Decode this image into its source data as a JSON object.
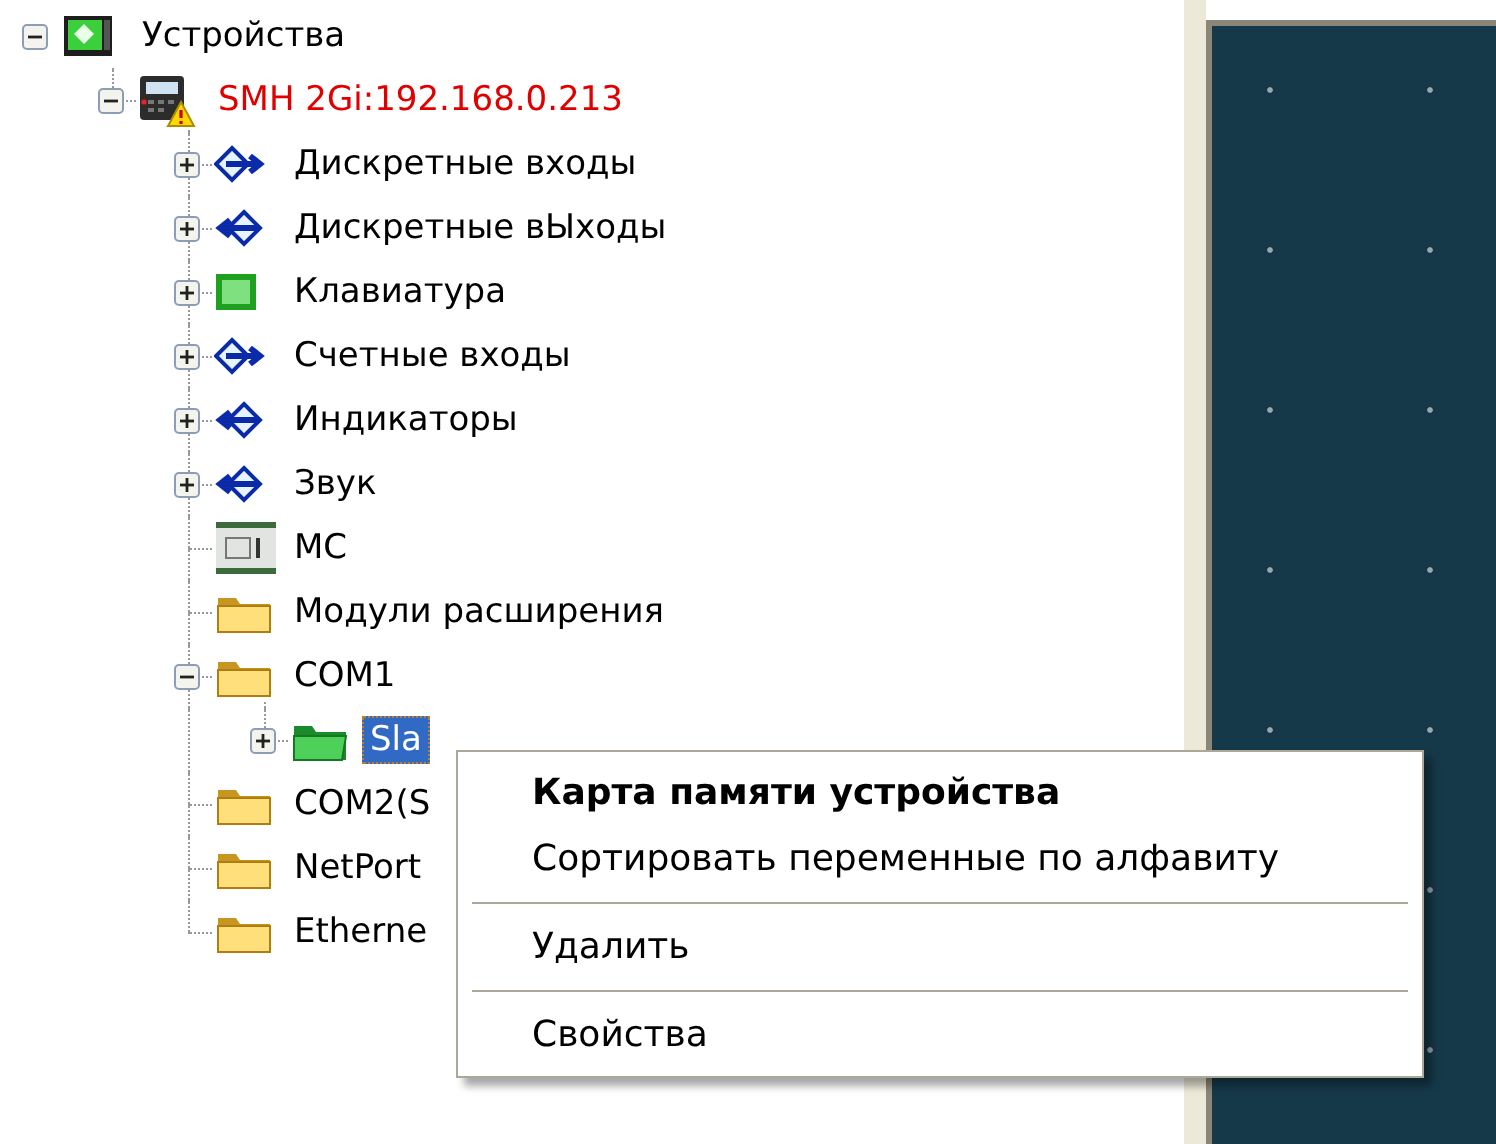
{
  "tree": [
    {
      "label": "Устройства",
      "kind": "devices",
      "toggle": true,
      "expanded": true,
      "selected": false,
      "warning": false,
      "children": [
        {
          "label": "SMH 2Gi:192.168.0.213",
          "kind": "controller",
          "toggle": true,
          "expanded": true,
          "selected": false,
          "warning": true,
          "children": [
            {
              "label": "Дискретные входы",
              "kind": "arrow-in",
              "toggle": true,
              "expanded": false,
              "selected": false,
              "warning": false
            },
            {
              "label": "Дискретные вЫходы",
              "kind": "arrow-out",
              "toggle": true,
              "expanded": false,
              "selected": false,
              "warning": false
            },
            {
              "label": "Клавиатура",
              "kind": "keypad",
              "toggle": true,
              "expanded": false,
              "selected": false,
              "warning": false
            },
            {
              "label": "Счетные входы",
              "kind": "arrow-in",
              "toggle": true,
              "expanded": false,
              "selected": false,
              "warning": false
            },
            {
              "label": "Индикаторы",
              "kind": "arrow-out",
              "toggle": true,
              "expanded": false,
              "selected": false,
              "warning": false
            },
            {
              "label": "Звук",
              "kind": "arrow-out",
              "toggle": true,
              "expanded": false,
              "selected": false,
              "warning": false
            },
            {
              "label": "MC",
              "kind": "module",
              "toggle": false,
              "selected": false,
              "warning": false
            },
            {
              "label": "Модули расширения",
              "kind": "folder",
              "toggle": false,
              "selected": false,
              "warning": false
            },
            {
              "label": "COM1",
              "kind": "folder",
              "toggle": true,
              "expanded": true,
              "selected": false,
              "warning": false,
              "children": [
                {
                  "label": "Sla",
                  "kind": "folder-green",
                  "toggle": true,
                  "expanded": false,
                  "selected": true,
                  "warning": false
                }
              ]
            },
            {
              "label": "COM2(S",
              "kind": "folder",
              "toggle": false,
              "selected": false,
              "warning": false
            },
            {
              "label": "NetPort",
              "kind": "folder",
              "toggle": false,
              "selected": false,
              "warning": false
            },
            {
              "label": "Etherne",
              "kind": "folder",
              "toggle": false,
              "selected": false,
              "warning": false
            }
          ]
        }
      ]
    }
  ],
  "context_menu": [
    {
      "kind": "item",
      "label": "Карта памяти устройства",
      "default": true
    },
    {
      "kind": "item",
      "label": "Сортировать переменные по алфавиту",
      "default": false
    },
    {
      "kind": "separator"
    },
    {
      "kind": "item",
      "label": "Удалить",
      "default": false
    },
    {
      "kind": "separator"
    },
    {
      "kind": "item",
      "label": "Свойства",
      "default": false
    }
  ]
}
